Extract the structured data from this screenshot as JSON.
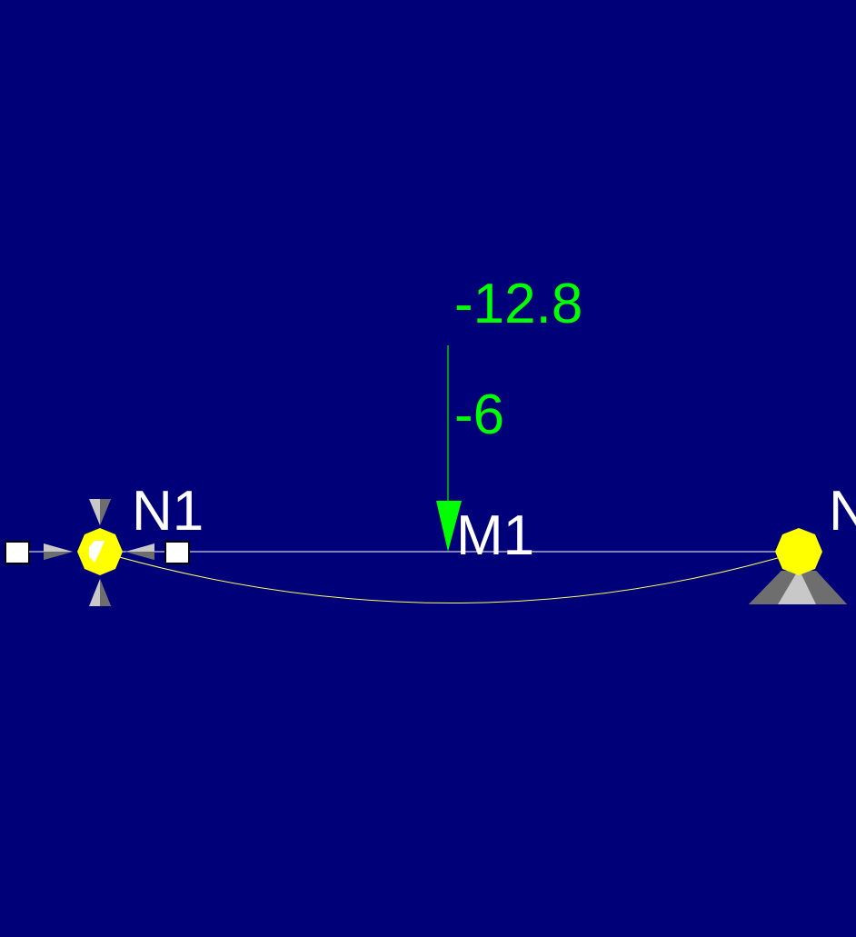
{
  "nodes": [
    {
      "label": "N1"
    },
    {
      "label": "N"
    }
  ],
  "member": {
    "label": "M1"
  },
  "load": {
    "value_top": "-12.8",
    "value_bottom": "-6"
  },
  "colors": {
    "background": "#000078",
    "member_line": "#ffffff",
    "deflection_curve": "#ffff66",
    "node_fill": "#ffff00",
    "load": "#00ff00",
    "support_light": "#c8c8c8",
    "support_dark": "#6e6e6e",
    "text": "#ffffff"
  }
}
